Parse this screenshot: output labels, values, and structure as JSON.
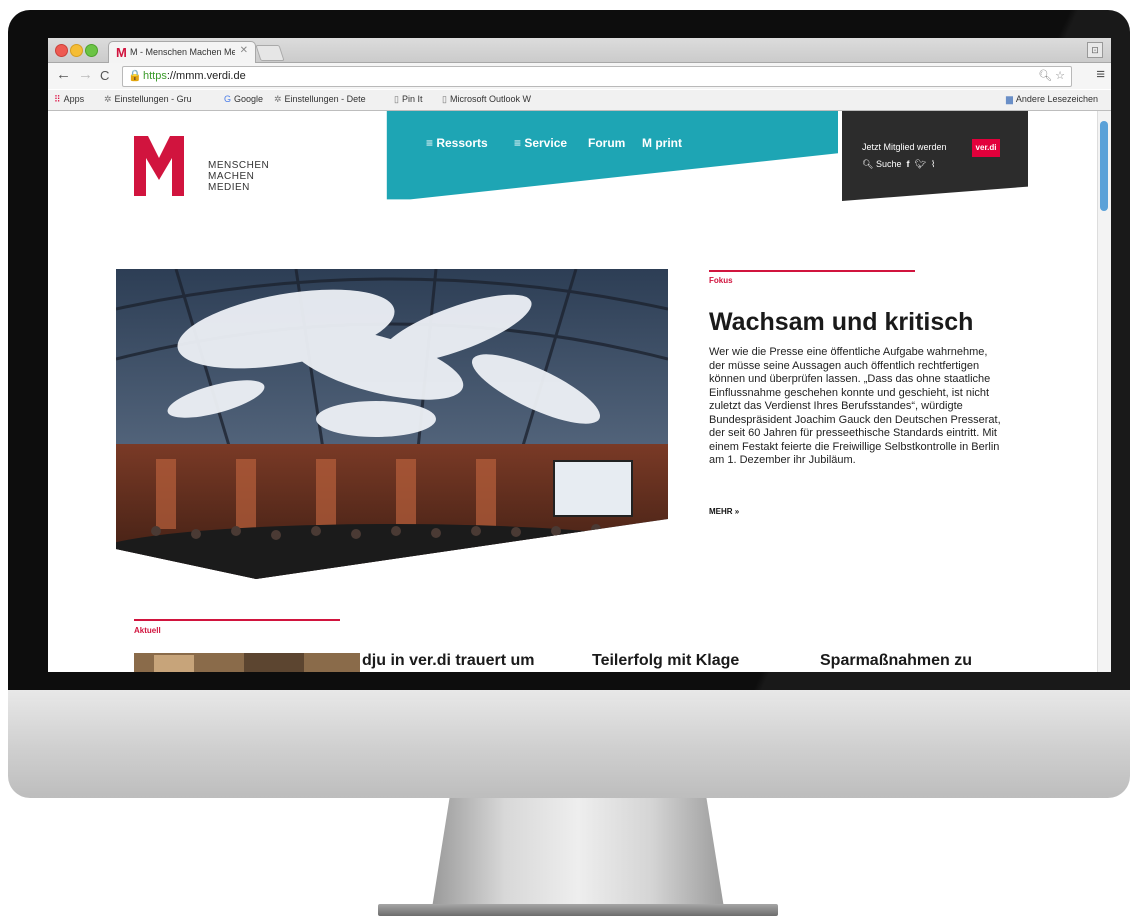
{
  "browser": {
    "tab_title": "M - Menschen Machen Me",
    "tab_favicon": "M",
    "url_scheme": "https",
    "url_rest": "://mmm.verdi.de",
    "bookmarks": [
      {
        "label": "Apps",
        "icon": "apps-grid-icon"
      },
      {
        "label": "Einstellungen - Gru",
        "icon": "gear-icon"
      },
      {
        "label": "Google",
        "icon": "google-icon"
      },
      {
        "label": "Einstellungen - Dete",
        "icon": "gear-icon"
      },
      {
        "label": "Pin It",
        "icon": "page-icon"
      },
      {
        "label": "Microsoft Outlook W",
        "icon": "page-icon"
      }
    ],
    "other_bookmarks": "Andere Lesezeichen"
  },
  "site": {
    "logo_letter": "M",
    "logo_lines": [
      "MENSCHEN",
      "MACHEN",
      "MEDIEN"
    ],
    "nav": [
      "≡ Ressorts",
      "≡ Service",
      "Forum",
      "M print"
    ],
    "join_label": "Jetzt Mitglied werden",
    "verdi_badge": "ver.di",
    "search_label": "Suche"
  },
  "focus": {
    "kicker": "Fokus",
    "headline": "Wachsam und kritisch",
    "body": "Wer wie die Presse eine öffentliche Aufgabe wahrnehme, der müsse seine Aussagen auch öffentlich rechtfertigen können und überprüfen lassen. „Dass das ohne staatliche Einflussnahme geschehen konnte und geschieht, ist nicht zuletzt das Verdienst Ihres Berufsstandes“, würdigte Bundespräsident Joachim Gauck den Deutschen Presserat, der seit 60 Jahren für presseethische Standards eintritt. Mit einem Festakt feierte die Freiwillige Selbstkontrolle in Berlin am 1. Dezember ihr Jubiläum.",
    "more": "MEHR »"
  },
  "aktuell": {
    "kicker": "Aktuell",
    "teasers": [
      "dju in ver.di trauert um",
      "Teilerfolg mit Klage",
      "Sparmaßnahmen zu"
    ]
  },
  "colors": {
    "brand_red": "#d1143e",
    "nav_teal": "#1ea5b4",
    "dark_box": "#2c2c2c",
    "verdi_red": "#e2003b"
  }
}
